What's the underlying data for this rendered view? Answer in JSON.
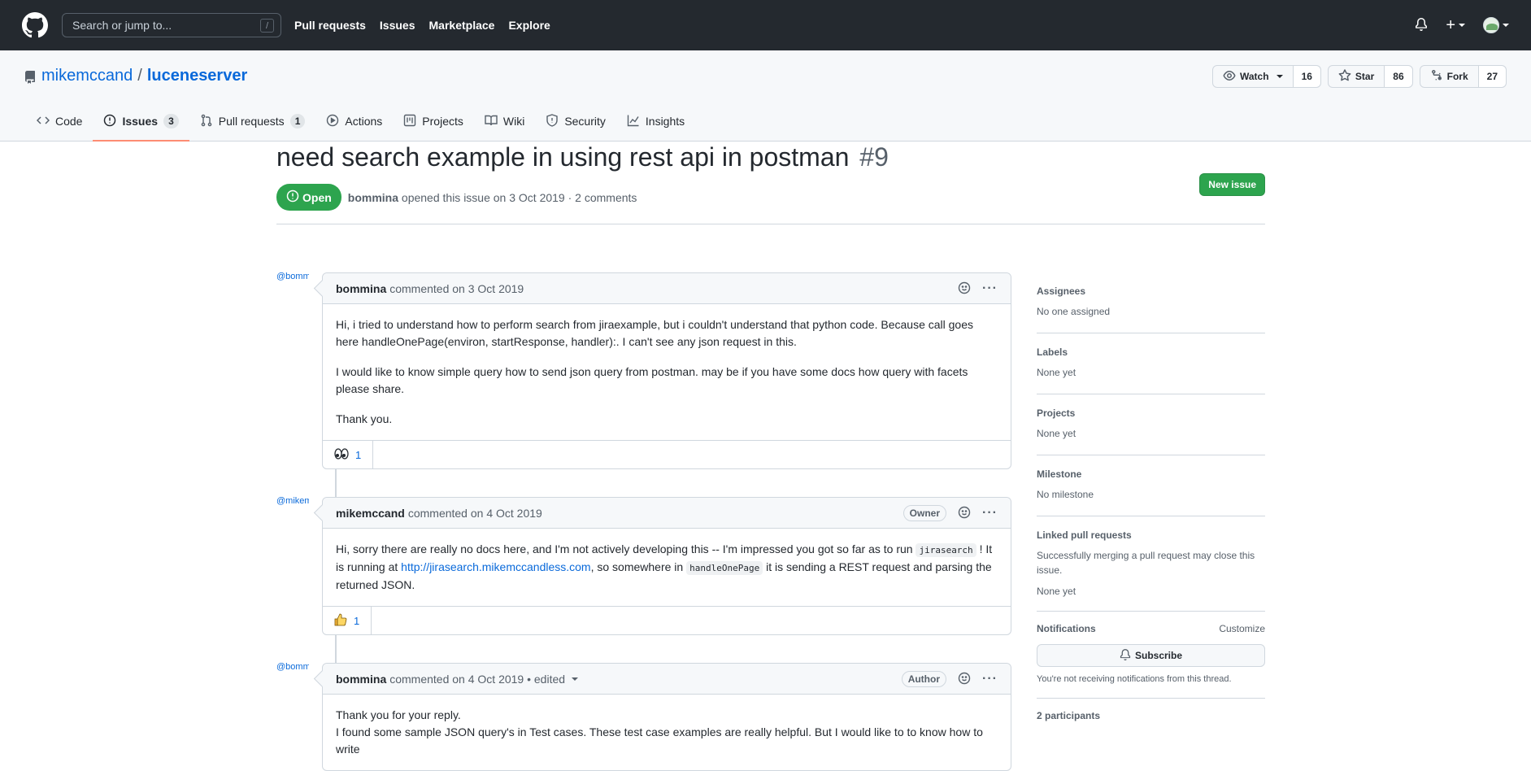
{
  "topnav": {
    "search_placeholder": "Search or jump to...",
    "search_shortcut": "/",
    "links": [
      "Pull requests",
      "Issues",
      "Marketplace",
      "Explore"
    ]
  },
  "repo": {
    "owner": "mikemccand",
    "separator": "/",
    "name": "luceneserver",
    "watch_label": "Watch",
    "watch_count": "16",
    "star_label": "Star",
    "star_count": "86",
    "fork_label": "Fork",
    "fork_count": "27"
  },
  "tabs": [
    {
      "label": "Code",
      "counter": ""
    },
    {
      "label": "Issues",
      "counter": "3"
    },
    {
      "label": "Pull requests",
      "counter": "1"
    },
    {
      "label": "Actions",
      "counter": ""
    },
    {
      "label": "Projects",
      "counter": ""
    },
    {
      "label": "Wiki",
      "counter": ""
    },
    {
      "label": "Security",
      "counter": ""
    },
    {
      "label": "Insights",
      "counter": ""
    }
  ],
  "issue": {
    "title": "need search example in using rest api in postman",
    "number": "#9",
    "new_issue_label": "New issue",
    "state": "Open",
    "author": "bommina",
    "opened_text": "opened this issue on 3 Oct 2019 · 2 comments"
  },
  "comments": [
    {
      "avatar_alt": "@bommina",
      "author": "bommina",
      "date_text": "commented on 3 Oct 2019",
      "badge": "",
      "body1": "Hi, i tried to understand how to perform search from jiraexample, but i couldn't understand that python code. Because call goes here handleOnePage(environ, startResponse, handler):. I can't see any json request in this.",
      "body2": "I would like to know simple query how to send json query from postman. may be if you have some docs how query with facets please share.",
      "body3": "Thank you.",
      "reaction_count": "1"
    },
    {
      "avatar_alt": "@mikemccand",
      "author": "mikemccand",
      "date_text": "commented on 4 Oct 2019",
      "badge": "Owner",
      "body_a": "Hi, sorry there are really no docs here, and I'm not actively developing this -- I'm impressed you got so far as to run",
      "code1": "jirasearch",
      "body_b": "! It is running at",
      "link": "http://jirasearch.mikemccandless.com",
      "body_c": ", so somewhere in",
      "code2": "handleOnePage",
      "body_d": "it is sending a REST request and parsing the returned JSON.",
      "reaction_count": "1"
    },
    {
      "avatar_alt": "@bommina",
      "author": "bommina",
      "date_text": "commented on 4 Oct 2019 • edited",
      "badge": "Author",
      "body1": "Thank you for your reply.",
      "body2": "I found some sample JSON query's in Test cases. These test case examples are really helpful. But I would like to to know how to write"
    }
  ],
  "sidebar": {
    "assignees_label": "Assignees",
    "assignees_value": "No one assigned",
    "labels_label": "Labels",
    "labels_value": "None yet",
    "projects_label": "Projects",
    "projects_value": "None yet",
    "milestone_label": "Milestone",
    "milestone_value": "No milestone",
    "linked_label": "Linked pull requests",
    "linked_note": "Successfully merging a pull request may close this issue.",
    "linked_value": "None yet",
    "notifications_label": "Notifications",
    "customize_label": "Customize",
    "subscribe_label": "Subscribe",
    "notifications_note": "You're not receiving notifications from this thread.",
    "participants_label": "2 participants"
  }
}
